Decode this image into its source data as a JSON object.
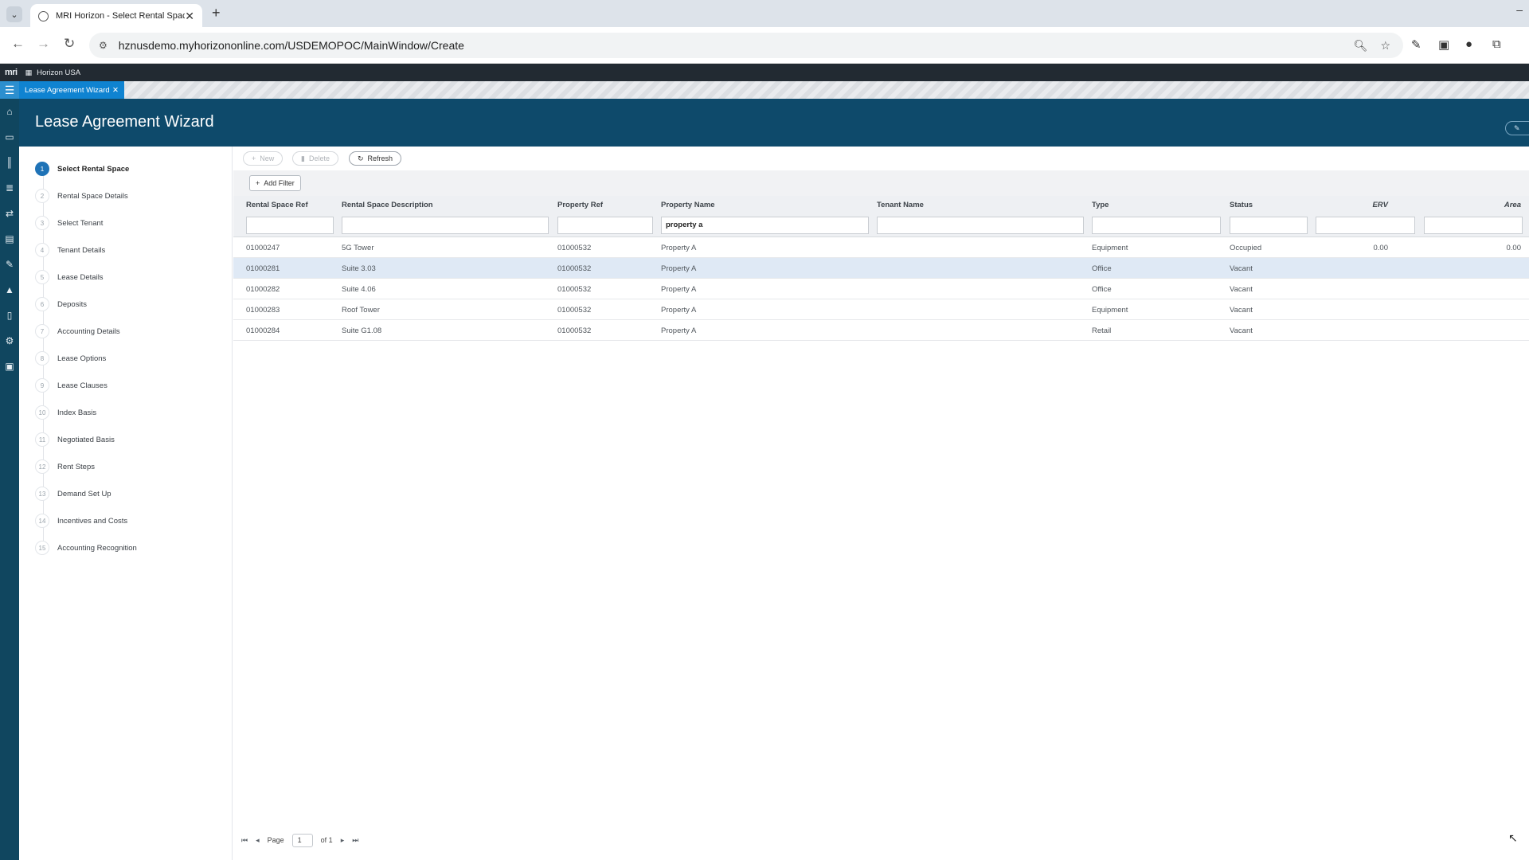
{
  "browser": {
    "tab_title": "MRI Horizon - Select Rental Space",
    "url": "hznusdemo.myhorizononline.com/USDEMOPOC/MainWindow/Create"
  },
  "app": {
    "brand": "mri",
    "org": "Horizon USA",
    "window_tab": "Lease Agreement Wizard",
    "page_title": "Lease Agreement Wizard",
    "accent_color": "#1f73b7",
    "header_color": "#0e4a6b"
  },
  "steps": [
    {
      "n": "1",
      "label": "Select Rental Space"
    },
    {
      "n": "2",
      "label": "Rental Space Details"
    },
    {
      "n": "3",
      "label": "Select Tenant"
    },
    {
      "n": "4",
      "label": "Tenant Details"
    },
    {
      "n": "5",
      "label": "Lease Details"
    },
    {
      "n": "6",
      "label": "Deposits"
    },
    {
      "n": "7",
      "label": "Accounting Details"
    },
    {
      "n": "8",
      "label": "Lease Options"
    },
    {
      "n": "9",
      "label": "Lease Clauses"
    },
    {
      "n": "10",
      "label": "Index Basis"
    },
    {
      "n": "11",
      "label": "Negotiated Basis"
    },
    {
      "n": "12",
      "label": "Rent Steps"
    },
    {
      "n": "13",
      "label": "Demand Set Up"
    },
    {
      "n": "14",
      "label": "Incentives and Costs"
    },
    {
      "n": "15",
      "label": "Accounting Recognition"
    }
  ],
  "toolbar": {
    "new_label": "New",
    "delete_label": "Delete",
    "refresh_label": "Refresh",
    "add_filter_label": "Add Filter"
  },
  "table": {
    "columns": [
      "Rental Space Ref",
      "Rental Space Description",
      "Property Ref",
      "Property Name",
      "Tenant Name",
      "Type",
      "Status",
      "ERV",
      "Area"
    ],
    "filter_property_name": "property a",
    "rows": [
      {
        "ref": "01000247",
        "desc": "5G Tower",
        "prop_ref": "01000532",
        "prop_name": "Property A",
        "tenant": "",
        "type": "Equipment",
        "status": "Occupied",
        "erv": "0.00",
        "area": "0.00"
      },
      {
        "ref": "01000281",
        "desc": "Suite 3.03",
        "prop_ref": "01000532",
        "prop_name": "Property A",
        "tenant": "",
        "type": "Office",
        "status": "Vacant",
        "erv": "",
        "area": ""
      },
      {
        "ref": "01000282",
        "desc": "Suite 4.06",
        "prop_ref": "01000532",
        "prop_name": "Property A",
        "tenant": "",
        "type": "Office",
        "status": "Vacant",
        "erv": "",
        "area": ""
      },
      {
        "ref": "01000283",
        "desc": "Roof Tower",
        "prop_ref": "01000532",
        "prop_name": "Property A",
        "tenant": "",
        "type": "Equipment",
        "status": "Vacant",
        "erv": "",
        "area": ""
      },
      {
        "ref": "01000284",
        "desc": "Suite G1.08",
        "prop_ref": "01000532",
        "prop_name": "Property A",
        "tenant": "",
        "type": "Retail",
        "status": "Vacant",
        "erv": "",
        "area": ""
      }
    ]
  },
  "pager": {
    "page_label": "Page",
    "page_value": "1",
    "of_label": "of 1"
  }
}
